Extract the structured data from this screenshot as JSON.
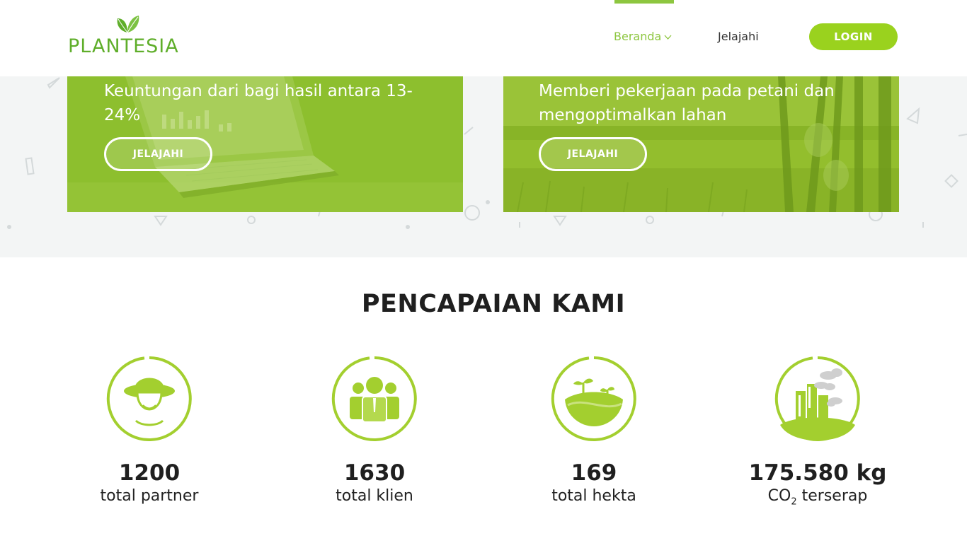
{
  "brand": {
    "name": "PLANTESIA",
    "accent": "#8dc63f",
    "button_color": "#9ad21e"
  },
  "nav": {
    "items": [
      {
        "label": "Beranda",
        "active": true,
        "has_dropdown": true
      },
      {
        "label": "Jelajahi",
        "active": false
      }
    ],
    "login_label": "LOGIN"
  },
  "cards": [
    {
      "text": "Keuntungan dari bagi hasil antara 13-24%",
      "button_label": "JELAJAHI"
    },
    {
      "text": "Memberi pekerjaan pada petani dan mengoptimalkan lahan",
      "button_label": "JELAJAHI"
    }
  ],
  "achievements": {
    "title": "PENCAPAIAN KAMI",
    "stats": [
      {
        "icon": "farmer-icon",
        "value": "1200",
        "label": "total partner"
      },
      {
        "icon": "clients-icon",
        "value": "1630",
        "label": "total klien"
      },
      {
        "icon": "land-sprout-icon",
        "value": "169",
        "label": "total hekta"
      },
      {
        "icon": "co2-factory-icon",
        "value": "175.580 kg",
        "label_prefix": "CO",
        "label_sub": "2",
        "label_suffix": " terserap"
      }
    ]
  }
}
